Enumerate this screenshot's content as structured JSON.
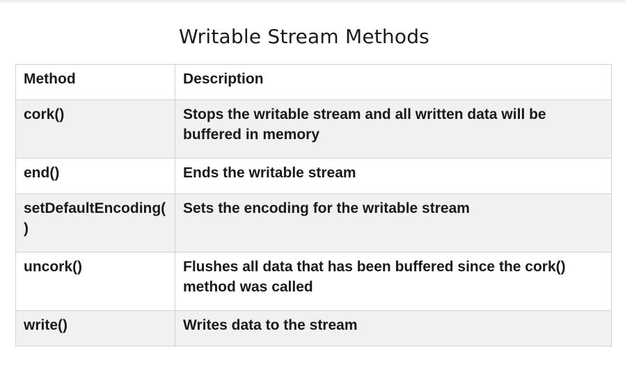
{
  "title": "Writable Stream Methods",
  "table": {
    "headers": {
      "method": "Method",
      "description": "Description"
    },
    "rows": [
      {
        "method": "cork()",
        "description": "Stops the writable stream and all written data will be buffered in memory"
      },
      {
        "method": "end()",
        "description": "Ends the writable stream"
      },
      {
        "method": "setDefaultEncoding()",
        "description": "Sets the encoding for the writable stream"
      },
      {
        "method": "uncork()",
        "description": "Flushes all data that has been buffered since the cork() method was called"
      },
      {
        "method": "write()",
        "description": "Writes data to the stream"
      }
    ]
  },
  "colors": {
    "stripe": "#f1f1f1",
    "border": "#d2d2d2",
    "text": "#1a1a1a"
  }
}
